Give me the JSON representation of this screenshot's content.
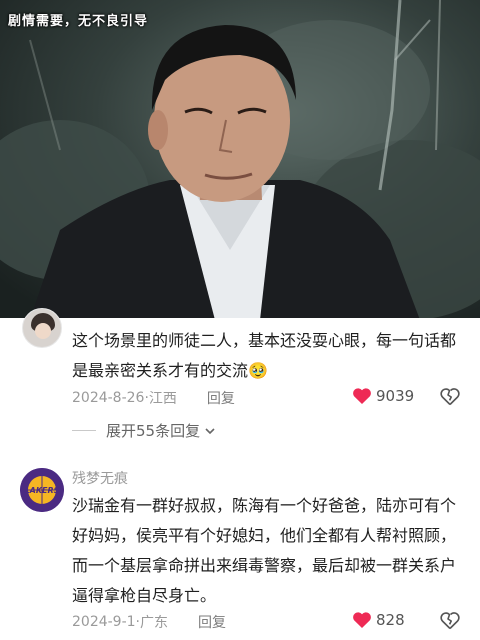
{
  "overlay": {
    "disclaimer": "剧情需要，无不良引导"
  },
  "comments": [
    {
      "text": "这个场景里的师徒二人，基本还没耍心眼，每一句话都是最亲密关系才有的交流🥹",
      "date": "2024-8-26",
      "location": "江西",
      "reply_label": "回复",
      "likes": "9039"
    },
    {
      "username": "残梦无痕",
      "avatar_text": "LAKERS",
      "text": "沙瑞金有一群好叔叔，陈海有一个好爸爸，陆亦可有个好妈妈，侯亮平有个好媳妇，他们全都有人帮衬照顾，而一个基层拿命拼出来缉毒警察，最后却被一群关系户逼得拿枪自尽身亡。",
      "date": "2024-9-1",
      "location": "广东",
      "reply_label": "回复",
      "likes": "828"
    }
  ],
  "expand_replies": "展开55条回复",
  "colors": {
    "like_heart": "#ee2a55",
    "lakers_purple": "#4b2a82",
    "lakers_gold": "#f5b623",
    "meta_gray": "#9a9a9a"
  },
  "icons": {
    "like": "heart-icon",
    "dislike": "broken-heart-icon",
    "expand": "chevron-down-icon"
  }
}
